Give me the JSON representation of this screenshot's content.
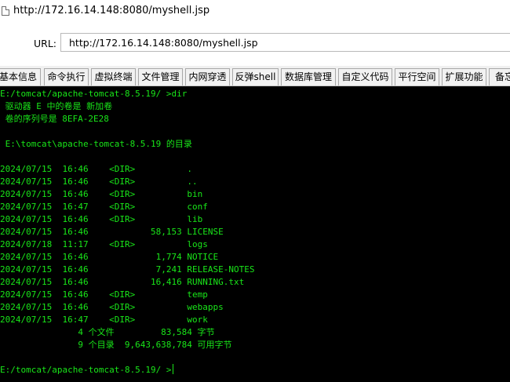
{
  "window": {
    "title": "http://172.16.14.148:8080/myshell.jsp"
  },
  "address": {
    "label": "URL:",
    "value": "http://172.16.14.148:8080/myshell.jsp"
  },
  "tabs": [
    {
      "label": "基本信息"
    },
    {
      "label": "命令执行"
    },
    {
      "label": "虚拟终端"
    },
    {
      "label": "文件管理"
    },
    {
      "label": "内网穿透"
    },
    {
      "label": "反弹shell"
    },
    {
      "label": "数据库管理"
    },
    {
      "label": "自定义代码"
    },
    {
      "label": "平行空间"
    },
    {
      "label": "扩展功能"
    },
    {
      "label": "备忘"
    }
  ],
  "terminal": {
    "text_color": "#19e619",
    "background": "#000000",
    "lines": [
      "E:/tomcat/apache-tomcat-8.5.19/ >dir",
      " 驱动器 E 中的卷是 新加卷",
      " 卷的序列号是 8EFA-2E28",
      "",
      " E:\\tomcat\\apache-tomcat-8.5.19 的目录",
      "",
      "2024/07/15  16:46    <DIR>          .",
      "2024/07/15  16:46    <DIR>          ..",
      "2024/07/15  16:46    <DIR>          bin",
      "2024/07/15  16:47    <DIR>          conf",
      "2024/07/15  16:46    <DIR>          lib",
      "2024/07/15  16:46            58,153 LICENSE",
      "2024/07/18  11:17    <DIR>          logs",
      "2024/07/15  16:46             1,774 NOTICE",
      "2024/07/15  16:46             7,241 RELEASE-NOTES",
      "2024/07/15  16:46            16,416 RUNNING.txt",
      "2024/07/15  16:46    <DIR>          temp",
      "2024/07/15  16:46    <DIR>          webapps",
      "2024/07/15  16:47    <DIR>          work",
      "               4 个文件         83,584 字节",
      "               9 个目录  9,643,638,784 可用字节",
      "",
      "E:/tomcat/apache-tomcat-8.5.19/ >"
    ]
  }
}
